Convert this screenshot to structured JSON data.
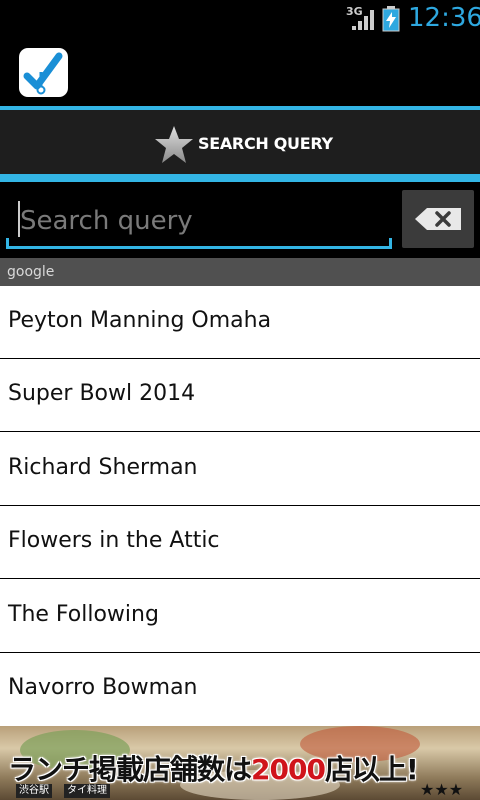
{
  "status_bar": {
    "network": "3G",
    "time": "12:36"
  },
  "action_bar": {
    "app_icon": "checkmark-broom-app-icon"
  },
  "tab": {
    "label": "SEARCH QUERY",
    "icon": "star-icon"
  },
  "search": {
    "placeholder": "Search query",
    "value": "",
    "clear_icon": "backspace-clear-icon"
  },
  "section": {
    "title": "google"
  },
  "suggestions": [
    "Peyton Manning Omaha",
    "Super Bowl 2014",
    "Richard Sherman",
    "Flowers in the Attic",
    "The Following",
    "Navorro Bowman"
  ],
  "ad": {
    "text_before": "ランチ掲載店舗数は",
    "text_highlight": "2000",
    "text_after": "店以上!",
    "station": "渋谷駅",
    "cuisine": "タイ料理",
    "stars": "★★★"
  },
  "colors": {
    "accent": "#33b5e5",
    "clock": "#2ea8e0",
    "section_header": "#505050"
  }
}
